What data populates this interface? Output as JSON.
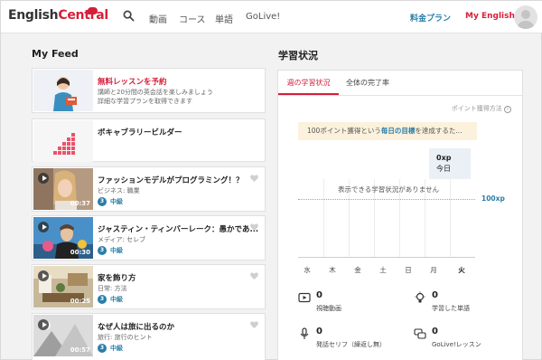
{
  "header": {
    "logo_part1": "English",
    "logo_part2": "Central",
    "nav": [
      "動画",
      "コース",
      "単語",
      "GoLive!"
    ],
    "plan_link": "料金プラン",
    "my_english": "My English"
  },
  "feed": {
    "title": "My Feed",
    "promo_cards": [
      {
        "title": "無料レッスンを予約",
        "sub1": "講師と20分間の英会話を楽しみましょう",
        "sub2": "詳細な学習プランを取得できます"
      },
      {
        "title": "ボキャブラリービルダー"
      }
    ],
    "videos": [
      {
        "title": "ファッションモデルがプログラミング！？",
        "category": "ビジネス: 職業",
        "duration": "00:37",
        "level_num": "3",
        "level": "中級"
      },
      {
        "title": "ジャスティン・ティンバーレーク：愚かであ...",
        "category": "メディア: セレブ",
        "duration": "00:30",
        "level_num": "3",
        "level": "中級"
      },
      {
        "title": "家を飾り方",
        "category": "日常: 方法",
        "duration": "00:25",
        "level_num": "3",
        "level": "中級"
      },
      {
        "title": "なぜ人は旅に出るのか",
        "category": "旅行: 旅行のヒント",
        "duration": "00:57",
        "level_num": "3",
        "level": "中級"
      }
    ]
  },
  "stats": {
    "title": "学習状況",
    "tabs": [
      "週の学習状況",
      "全体の完了率"
    ],
    "points_link": "ポイント獲得方法",
    "goal_text_pre": "100ポイント獲得という",
    "goal_text_hl": "毎日の目標",
    "goal_text_post": "を達成するた...",
    "xp_value": "0xp",
    "xp_label": "今日",
    "no_data": "表示できる学習状況がありません",
    "goal_value": "100xp",
    "days": [
      "水",
      "木",
      "金",
      "土",
      "日",
      "月",
      "火"
    ],
    "items": [
      {
        "value": "0",
        "label": "視聴動画",
        "icon": "video-icon"
      },
      {
        "value": "0",
        "label": "学習した単語",
        "icon": "lightbulb-icon"
      },
      {
        "value": "0",
        "label": "発話セリフ（繰返し無）",
        "icon": "microphone-icon"
      },
      {
        "value": "0",
        "label": "GoLive!レッスン",
        "icon": "chat-bubbles-icon"
      }
    ]
  },
  "colors": {
    "brand_red": "#d61f3a",
    "link_blue": "#2a7ea8",
    "goal_bg": "#fbf1dc"
  }
}
